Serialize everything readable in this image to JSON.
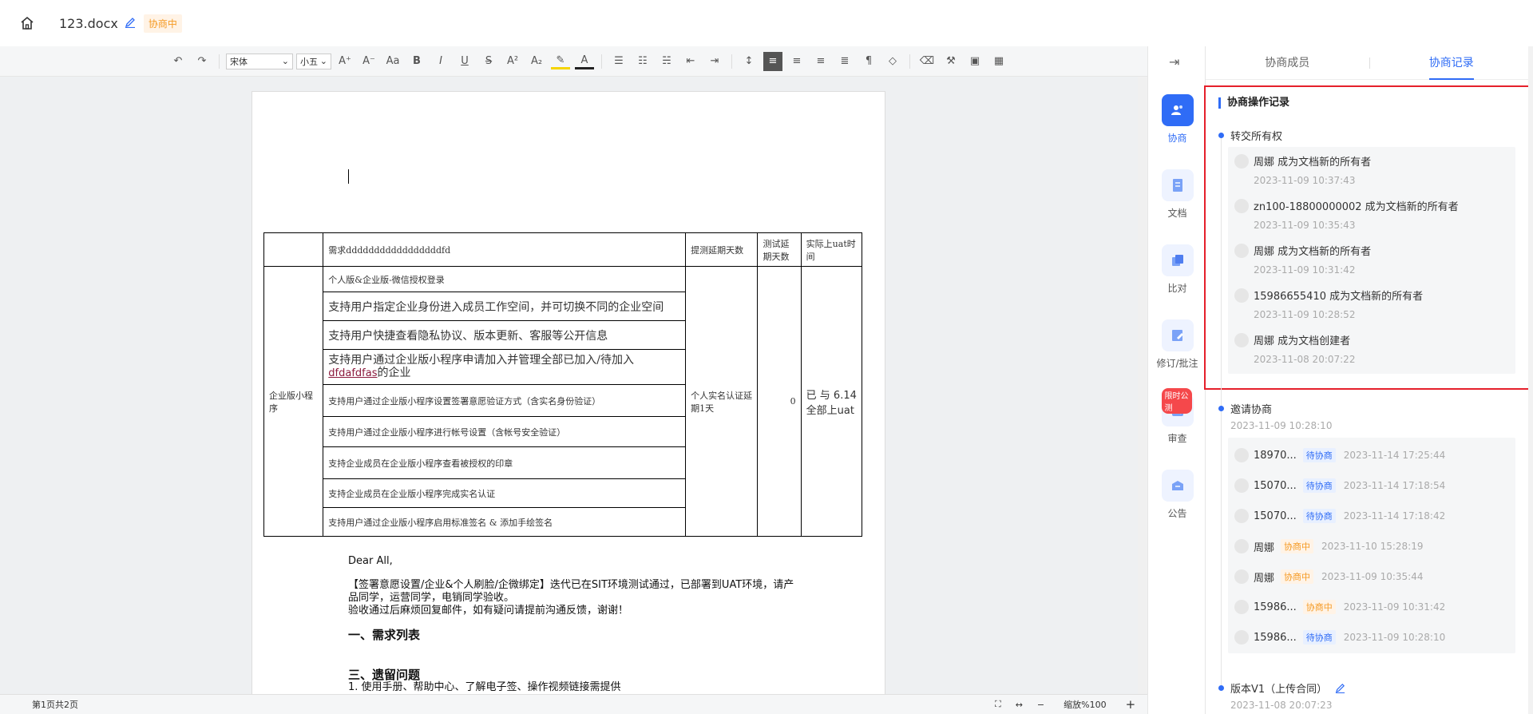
{
  "header": {
    "filename": "123.docx",
    "status": "协商中"
  },
  "toolbar": {
    "font": "宋体",
    "size": "小五"
  },
  "document": {
    "table": {
      "header": [
        "",
        "需求dddddddddddddddddfd",
        "提测延期天数",
        "测试延期天数",
        "实际上uat时间"
      ],
      "row_label": "企业版小程序",
      "items": [
        "个人版&企业版-微信授权登录",
        "支持用户指定企业身份进入成员工作空间，并可切换不同的企业空间",
        "支持用户快捷查看隐私协议、版本更新、客服等公开信息",
        "支持用户通过企业版小程序申请加入并管理全部已加入/待加入",
        "支持用户通过企业版小程序设置签署意愿验证方式（含实名身份验证）",
        "支持用户通过企业版小程序进行帐号设置（含帐号安全验证）",
        "支持企业成员在企业版小程序查看被授权的印章",
        "支持企业成员在企业版小程序完成实名认证",
        "支持用户通过企业版小程序启用标准签名 & 添加手绘签名"
      ],
      "item4_link": "dfdafdfas",
      "item4_suffix": "的企业",
      "delay_text": "个人实名认证延期1天",
      "test_delay": "0",
      "uat_text": "已 与 6.14全部上uat"
    },
    "greeting": "Dear All,",
    "para1": "【签署意愿设置/企业&个人刷脸/企微绑定】迭代已在SIT环境测试通过，已部署到UAT环境，请产品同学，运营同学，电销同学验收。",
    "para2": "验收通过后麻烦回复邮件，如有疑问请提前沟通反馈，谢谢！",
    "heading1": "一、需求列表",
    "heading3": "三、遗留问题",
    "line_last": "1. 使用手册、帮助中心、了解电子签、操作视频链接需提供"
  },
  "status_bar": {
    "pages": "第1页共2页",
    "zoom": "缩放%100"
  },
  "nav": [
    {
      "label": "协商",
      "icon": "negotiation-icon",
      "active": true
    },
    {
      "label": "文档",
      "icon": "document-icon"
    },
    {
      "label": "比对",
      "icon": "compare-icon"
    },
    {
      "label": "修订/批注",
      "icon": "revision-icon"
    },
    {
      "label": "审查",
      "icon": "review-icon",
      "promo": "限时公测"
    },
    {
      "label": "公告",
      "icon": "notice-icon"
    }
  ],
  "panel": {
    "tabs": [
      "协商成员",
      "协商记录"
    ],
    "section_title": "协商操作记录",
    "transfer_title": "转交所有权",
    "transfer_records": [
      {
        "text": "周娜 成为文档新的所有者",
        "time": "2023-11-09 10:37:43"
      },
      {
        "text": "zn100-18800000002 成为文档新的所有者",
        "time": "2023-11-09 10:35:43"
      },
      {
        "text": "周娜 成为文档新的所有者",
        "time": "2023-11-09 10:31:42"
      },
      {
        "text": "15986655410 成为文档新的所有者",
        "time": "2023-11-09 10:28:52"
      },
      {
        "text": "周娜 成为文档创建者",
        "time": "2023-11-08 20:07:22"
      }
    ],
    "invite_title": "邀请协商",
    "invite_time": "2023-11-09 10:28:10",
    "invites": [
      {
        "name": "18970...",
        "tag": "待协商",
        "tag_color": "blue",
        "time": "2023-11-14 17:25:44"
      },
      {
        "name": "15070...",
        "tag": "待协商",
        "tag_color": "blue",
        "time": "2023-11-14 17:18:54"
      },
      {
        "name": "15070...",
        "tag": "待协商",
        "tag_color": "blue",
        "time": "2023-11-14 17:18:42"
      },
      {
        "name": "周娜",
        "tag": "协商中",
        "tag_color": "orange",
        "time": "2023-11-10 15:28:19"
      },
      {
        "name": "周娜",
        "tag": "协商中",
        "tag_color": "orange",
        "time": "2023-11-09 10:35:44"
      },
      {
        "name": "15986...",
        "tag": "协商中",
        "tag_color": "orange",
        "time": "2023-11-09 10:31:42"
      },
      {
        "name": "15986...",
        "tag": "待协商",
        "tag_color": "blue",
        "time": "2023-11-09 10:28:10"
      }
    ],
    "version_title": "版本V1（上传合同）",
    "version_time": "2023-11-08 20:07:23"
  }
}
